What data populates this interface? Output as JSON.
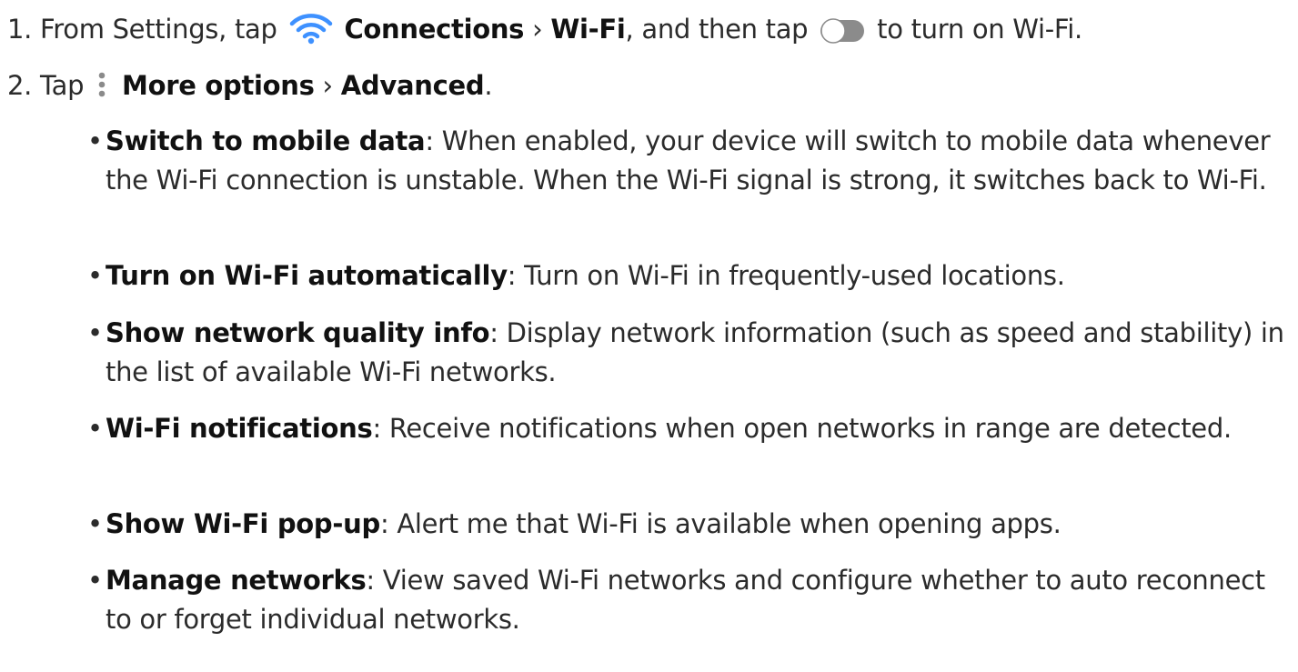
{
  "steps": [
    {
      "number": "1.",
      "text_1": "From Settings, tap",
      "icon_1": "wifi-icon",
      "bold_1": "Connections",
      "sep": "›",
      "bold_2": "Wi-Fi",
      "text_2": ", and then tap",
      "icon_2": "toggle-icon",
      "text_3": "to turn on Wi-Fi."
    },
    {
      "number": "2.",
      "text_1": "Tap",
      "icon_1": "more-options-icon",
      "bold_1": "More options",
      "sep": "›",
      "bold_2": "Advanced",
      "text_2": "."
    }
  ],
  "bullets": [
    {
      "term": "Switch to mobile data",
      "description": ": When enabled, your device will switch to mobile data whenever the Wi-Fi connection is unstable. When the Wi-Fi signal is strong, it switches back to Wi-Fi."
    },
    {
      "term": "Turn on Wi-Fi automatically",
      "description": ": Turn on Wi-Fi in frequently-used locations."
    },
    {
      "term": "Show network quality info",
      "description": ": Display network information (such as speed and stability) in the list of available Wi-Fi networks."
    },
    {
      "term": "Wi-Fi notifications",
      "description": ": Receive notifications when open networks in range are detected."
    },
    {
      "term": "Show Wi-Fi pop-up",
      "description": ": Alert me that Wi-Fi is available when opening apps."
    },
    {
      "term": "Manage networks",
      "description": ": View saved Wi-Fi networks and configure whether to auto reconnect to or forget individual networks."
    }
  ],
  "colors": {
    "wifi_icon": "#3e91ff",
    "toggle_track": "#8b8b8b",
    "toggle_knob": "#ffffff",
    "more_icon": "#8b8b8b",
    "text": "#2b2b2b",
    "bold_text": "#111111"
  }
}
